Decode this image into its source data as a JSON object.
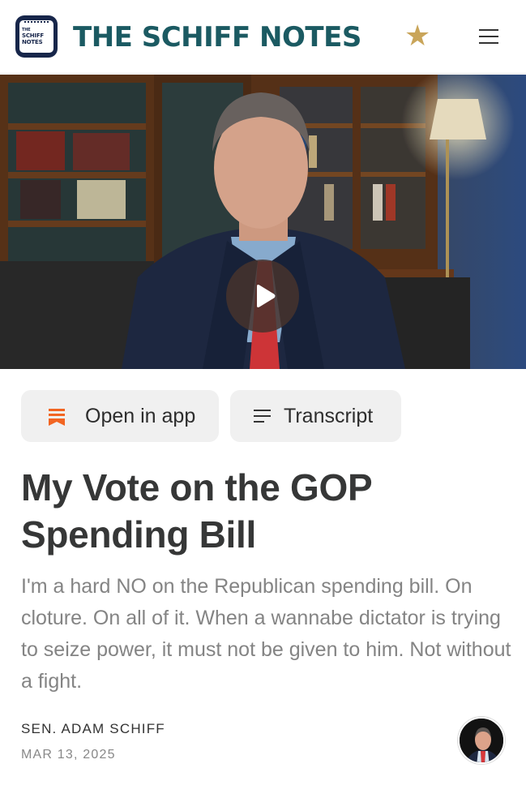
{
  "header": {
    "logo_text_top": "THE",
    "logo_text_mid": "SCHIFF",
    "logo_text_bottom": "NOTES",
    "brand_title": "THE SCHIFF NOTES",
    "brand_star": "★",
    "menu_icon": "hamburger-menu-icon",
    "colors": {
      "brand": "#1b5a62",
      "star": "#c9a55a",
      "logo_bg": "#17264a"
    }
  },
  "video": {
    "play_icon": "play-icon"
  },
  "actions": {
    "open_in_app_label": "Open in app",
    "open_in_app_icon": "bookmark-stack-icon",
    "transcript_label": "Transcript",
    "transcript_icon": "lines-icon",
    "accent": "#f26522"
  },
  "article": {
    "title": "My Vote on the GOP Spending Bill",
    "subtitle": "I'm a hard NO on the Republican spending bill. On cloture. On all of it. When a wannabe dictator is trying to seize power, it must not be given to him. Not without a fight.",
    "author": "SEN. ADAM SCHIFF",
    "date": "MAR 13, 2025"
  }
}
